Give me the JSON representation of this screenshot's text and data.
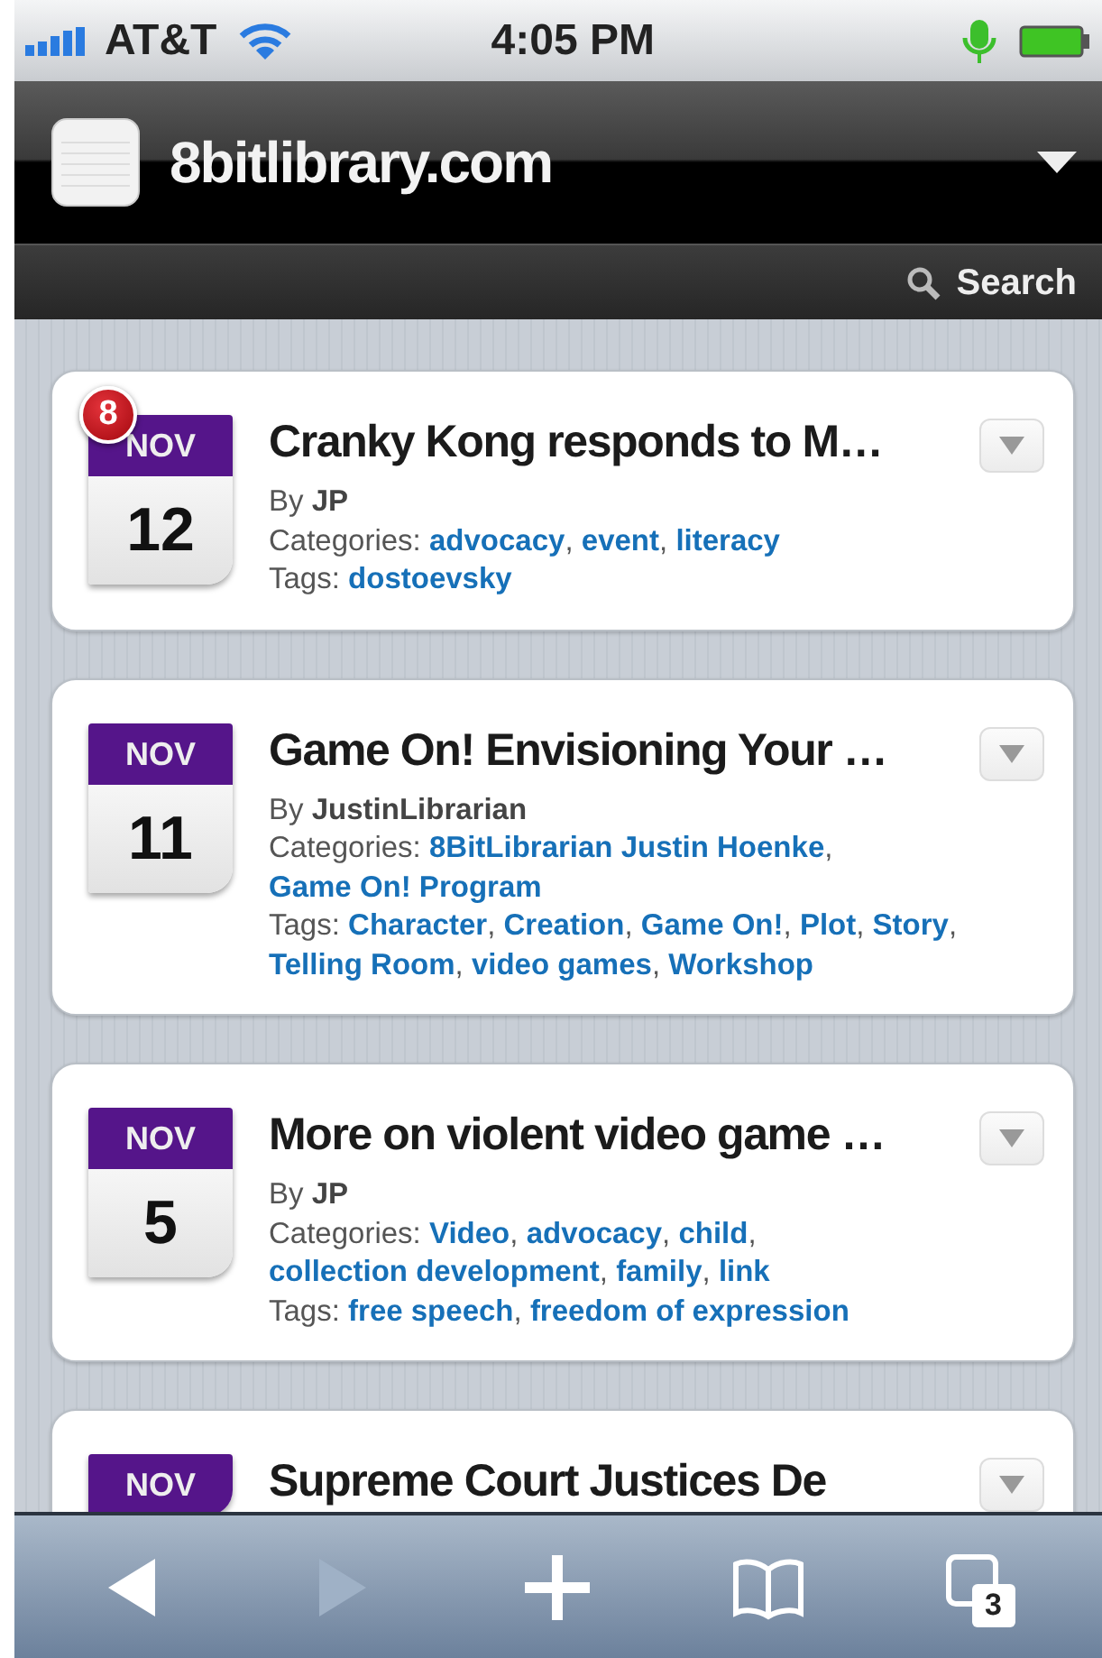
{
  "status_bar": {
    "carrier": "AT&T",
    "time": "4:05 PM"
  },
  "header": {
    "title": "8bitlibrary.com"
  },
  "search": {
    "label": "Search"
  },
  "list_separator": ",",
  "posts": [
    {
      "month": "NOV",
      "day": "12",
      "badge": "8",
      "title": "Cranky Kong responds to M…",
      "by_label": "By",
      "author": "JP",
      "categories_label": "Categories:",
      "categories": [
        "advocacy",
        "event",
        "literacy"
      ],
      "tags_label": "Tags:",
      "tags": [
        "dostoevsky"
      ]
    },
    {
      "month": "NOV",
      "day": "11",
      "title": "Game On! Envisioning Your …",
      "by_label": "By",
      "author": "JustinLibrarian",
      "categories_label": "Categories:",
      "categories": [
        "8BitLibrarian Justin Hoenke",
        "Game On! Program"
      ],
      "tags_label": "Tags:",
      "tags": [
        "Character",
        "Creation",
        "Game On!",
        "Plot",
        "Story",
        "Telling Room",
        "video games",
        "Workshop"
      ]
    },
    {
      "month": "NOV",
      "day": "5",
      "title": "More on violent video game …",
      "by_label": "By",
      "author": "JP",
      "categories_label": "Categories:",
      "categories": [
        "Video",
        "advocacy",
        "child",
        "collection development",
        "family",
        "link"
      ],
      "tags_label": "Tags:",
      "tags": [
        "free speech",
        "freedom of expression"
      ]
    },
    {
      "month": "NOV",
      "title": "Supreme Court Justices De"
    }
  ],
  "toolbar": [
    {
      "kind": "back",
      "disabled": false
    },
    {
      "kind": "forward",
      "disabled": true
    },
    {
      "kind": "add",
      "disabled": false
    },
    {
      "kind": "bookmarks",
      "disabled": false
    },
    {
      "kind": "tabs",
      "disabled": false,
      "count": "3"
    }
  ]
}
